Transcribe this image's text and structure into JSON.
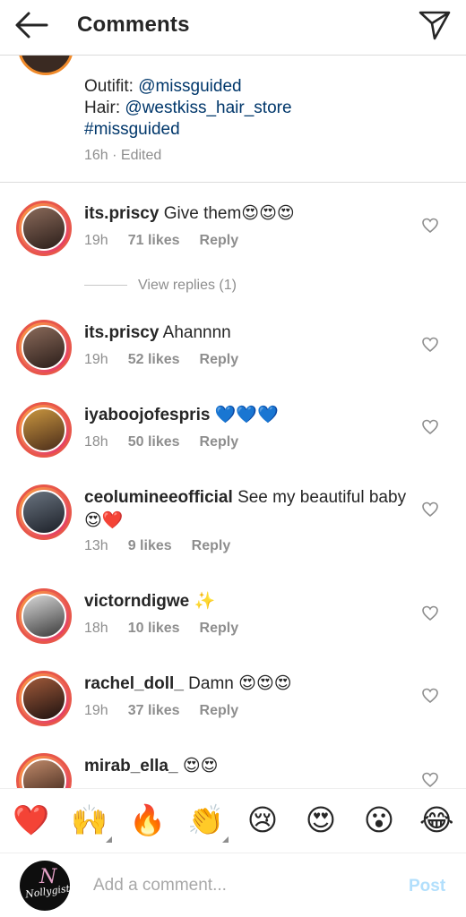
{
  "header": {
    "title": "Comments",
    "back_icon": "arrow-left-icon",
    "send_icon": "send-icon"
  },
  "caption": {
    "outfit_prefix": "Outifit: ",
    "outfit_handle": "@missguided",
    "hair_prefix": "Hair: ",
    "hair_handle": "@westkiss_hair_store",
    "hashtag": "#missguided",
    "time": "16h",
    "edited": "Edited"
  },
  "comments": [
    {
      "user": "its.priscy",
      "text": "Give them😍😍😍",
      "time": "19h",
      "likes": "71 likes",
      "reply": "Reply"
    },
    {
      "user": "its.priscy",
      "text": "Ahannnn",
      "time": "19h",
      "likes": "52 likes",
      "reply": "Reply"
    },
    {
      "user": "iyaboojofespris",
      "text": "💙💙💙",
      "time": "18h",
      "likes": "50 likes",
      "reply": "Reply"
    },
    {
      "user": "ceolumineeofficial",
      "text": "See my beautiful baby 😍❤️",
      "time": "13h",
      "likes": "9 likes",
      "reply": "Reply"
    },
    {
      "user": "victorndigwe",
      "text": "✨",
      "time": "18h",
      "likes": "10 likes",
      "reply": "Reply"
    },
    {
      "user": "rachel_doll_",
      "text": "Damn 😍😍😍",
      "time": "19h",
      "likes": "37 likes",
      "reply": "Reply"
    },
    {
      "user": "mirab_ella_",
      "text": "😍😍",
      "time": "",
      "likes": "",
      "reply": ""
    }
  ],
  "view_replies": "View replies (1)",
  "emoji_bar": [
    "❤️",
    "🙌",
    "🔥",
    "👏",
    "😢",
    "😍",
    "😮",
    "😂"
  ],
  "composer": {
    "avatar_text": "Nollygist",
    "placeholder": "Add a comment...",
    "post_label": "Post"
  },
  "colors": {
    "accent_link": "#00376b",
    "muted": "#8e8e8e",
    "post_disabled": "#b2dffc",
    "story_ring": "#e8574a"
  }
}
